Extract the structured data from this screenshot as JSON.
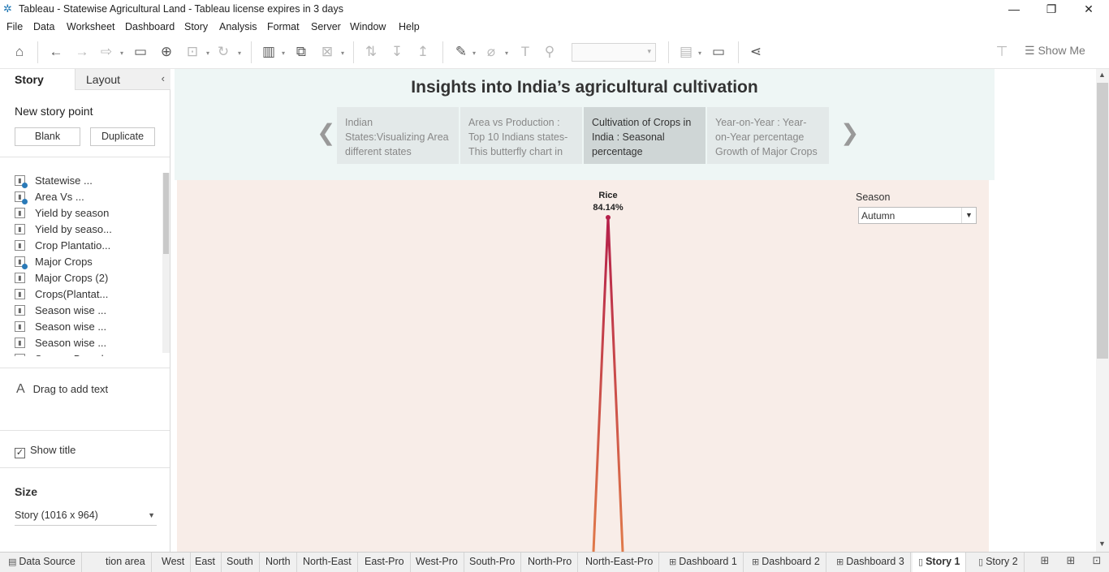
{
  "window": {
    "title": "Tableau - Statewise Agricultural Land - Tableau license expires in 3 days"
  },
  "menu": [
    "File",
    "Data",
    "Worksheet",
    "Dashboard",
    "Story",
    "Analysis",
    "Format",
    "Server",
    "Window",
    "Help"
  ],
  "toolbar": {
    "show_me_label": "Show Me"
  },
  "left_panel": {
    "tabs": {
      "story": "Story",
      "layout": "Layout"
    },
    "new_story_point": "New story point",
    "blank_label": "Blank",
    "duplicate_label": "Duplicate",
    "sheets": [
      {
        "label": "Statewise ...",
        "used": true
      },
      {
        "label": "Area Vs ...",
        "used": true
      },
      {
        "label": "Yield by season",
        "used": false
      },
      {
        "label": "Yield by seaso...",
        "used": false
      },
      {
        "label": "Crop Plantatio...",
        "used": false
      },
      {
        "label": "Major Crops",
        "used": true
      },
      {
        "label": "Major Crops (2)",
        "used": false
      },
      {
        "label": "Crops(Plantat...",
        "used": false
      },
      {
        "label": "Season wise ...",
        "used": false
      },
      {
        "label": "Season wise ...",
        "used": false
      },
      {
        "label": "Season wise ...",
        "used": false
      },
      {
        "label": "Season Based ...",
        "used": false
      }
    ],
    "drag_text": "Drag to add text",
    "show_title": "Show title",
    "size_label": "Size",
    "size_value": "Story (1016 x 964)"
  },
  "story": {
    "title": "Insights into India’s agricultural cultivation",
    "points": [
      {
        "text": "Indian States:Visualizing Area different states",
        "active": false
      },
      {
        "text": "Area vs Production : Top 10 Indians states-This butterfly chart in",
        "active": false
      },
      {
        "text": "Cultivation of Crops in India : Seasonal percentage",
        "active": true
      },
      {
        "text": "Year-on-Year : Year-on-Year percentage Growth of Major Crops",
        "active": false
      }
    ]
  },
  "dashboard": {
    "filter_label": "Season",
    "filter_value": "Autumn"
  },
  "chart_data": {
    "type": "line",
    "title": "",
    "points": [
      {
        "label": "Rice",
        "value_label": "84.14%",
        "value": 84.14
      }
    ],
    "colors": {
      "line_top": "#b5204a",
      "line_bottom": "#e07a4a"
    }
  },
  "bottom_tabs": [
    {
      "label": "Data Source",
      "icon": "database-icon",
      "active": false
    },
    {
      "label": "tion area",
      "icon": "",
      "active": false
    },
    {
      "label": "West",
      "icon": "",
      "active": false
    },
    {
      "label": "East",
      "icon": "",
      "active": false
    },
    {
      "label": "South",
      "icon": "",
      "active": false
    },
    {
      "label": "North",
      "icon": "",
      "active": false
    },
    {
      "label": "North-East",
      "icon": "",
      "active": false
    },
    {
      "label": "East-Pro",
      "icon": "",
      "active": false
    },
    {
      "label": "West-Pro",
      "icon": "",
      "active": false
    },
    {
      "label": "South-Pro",
      "icon": "",
      "active": false
    },
    {
      "label": "North-Pro",
      "icon": "",
      "active": false
    },
    {
      "label": "North-East-Pro",
      "icon": "",
      "active": false
    },
    {
      "label": "Dashboard 1",
      "icon": "dashboard-icon",
      "active": false
    },
    {
      "label": "Dashboard 2",
      "icon": "dashboard-icon",
      "active": false
    },
    {
      "label": "Dashboard 3",
      "icon": "dashboard-icon",
      "active": false
    },
    {
      "label": "Story 1",
      "icon": "story-icon",
      "active": true
    },
    {
      "label": "Story 2",
      "icon": "story-icon",
      "active": false
    }
  ]
}
